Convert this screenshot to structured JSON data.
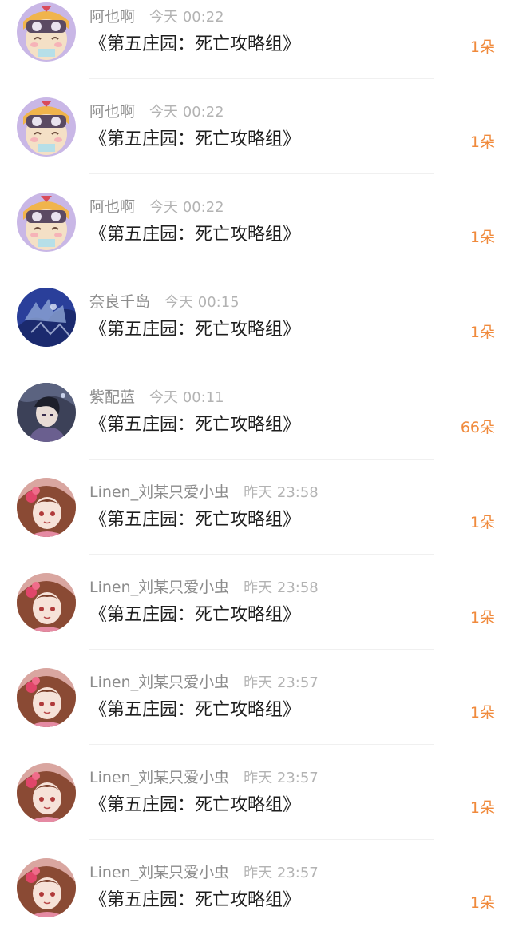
{
  "records": [
    {
      "user": "阿也啊",
      "time": "今天 00:22",
      "title": "《第五庄园：死亡攻略组》",
      "count": "1朵",
      "avatar_icon": "anime-girl-goggles-avatar"
    },
    {
      "user": "阿也啊",
      "time": "今天 00:22",
      "title": "《第五庄园：死亡攻略组》",
      "count": "1朵",
      "avatar_icon": "anime-girl-goggles-avatar"
    },
    {
      "user": "阿也啊",
      "time": "今天 00:22",
      "title": "《第五庄园：死亡攻略组》",
      "count": "1朵",
      "avatar_icon": "anime-girl-goggles-avatar"
    },
    {
      "user": "奈良千岛",
      "time": "今天 00:15",
      "title": "《第五庄园：死亡攻略组》",
      "count": "1朵",
      "avatar_icon": "blue-silhouette-avatar"
    },
    {
      "user": "紫配蓝",
      "time": "今天 00:11",
      "title": "《第五庄园：死亡攻略组》",
      "count": "66朵",
      "avatar_icon": "dark-haired-character-avatar"
    },
    {
      "user": "Linen_刘某只爱小虫",
      "time": "昨天 23:58",
      "title": "《第五庄园：死亡攻略组》",
      "count": "1朵",
      "avatar_icon": "anime-girl-flower-avatar"
    },
    {
      "user": "Linen_刘某只爱小虫",
      "time": "昨天 23:58",
      "title": "《第五庄园：死亡攻略组》",
      "count": "1朵",
      "avatar_icon": "anime-girl-flower-avatar"
    },
    {
      "user": "Linen_刘某只爱小虫",
      "time": "昨天 23:57",
      "title": "《第五庄园：死亡攻略组》",
      "count": "1朵",
      "avatar_icon": "anime-girl-flower-avatar"
    },
    {
      "user": "Linen_刘某只爱小虫",
      "time": "昨天 23:57",
      "title": "《第五庄园：死亡攻略组》",
      "count": "1朵",
      "avatar_icon": "anime-girl-flower-avatar"
    },
    {
      "user": "Linen_刘某只爱小虫",
      "time": "昨天 23:57",
      "title": "《第五庄园：死亡攻略组》",
      "count": "1朵",
      "avatar_icon": "anime-girl-flower-avatar"
    }
  ],
  "colors": {
    "count": "#f08a3c",
    "name": "#8c8c8c",
    "time": "#b3b3b3",
    "title": "#1f1f1f",
    "divider": "#f0f0f0"
  }
}
